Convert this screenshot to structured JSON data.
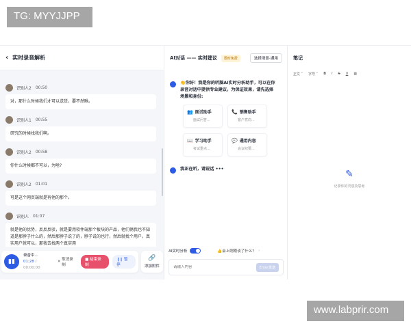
{
  "watermark_top": "TG: MYYJJPP",
  "watermark_bottom": "www.labprir.com",
  "left": {
    "title": "实时录音解析",
    "messages": [
      {
        "speaker": "识别人2",
        "time": "00:50",
        "text": "对，那什么时候我们才可以送货，要不然瞅。"
      },
      {
        "speaker": "识别人1",
        "time": "00:55",
        "text": "研究的时候找我们啊。"
      },
      {
        "speaker": "识别人2",
        "time": "00:58",
        "text": "你什么时候都不可以，为啥?"
      },
      {
        "speaker": "识别人2",
        "time": "01:01",
        "text": "可是这个网页端就是有他的那个。"
      },
      {
        "speaker": "识别人",
        "time": "01:07",
        "text": "就是他的优势，反反反驳，就是要用软件端那个板块的产品，他们俩我也不知道是那脖子什么的，然后那脖子说了的，脖子说的也行，然后就找个用户，真实用户就可以，那我去找两个真实用"
      }
    ],
    "recorder": {
      "status": "录音中...",
      "elapsed": "01:28",
      "total": "00:00:00",
      "cancel_label": "取消录制",
      "end_label": "结束录制",
      "pause_label": "暂停"
    },
    "attach_label": "添加附件"
  },
  "middle": {
    "title": "AI对话 —— 实时建议",
    "badge": "限时免费",
    "scene_button": "选择场景-通用",
    "greeting": "👏你好！我是你的听脑AI实时分析助手，可以在你录音对话中提供专业建议，为保证效果，请先选择场景和身份:",
    "cards": [
      {
        "icon": "👥",
        "title": "面试助手",
        "sub": "面试问答..."
      },
      {
        "icon": "📞",
        "title": "销售助手",
        "sub": "客户意向..."
      },
      {
        "icon": "📖",
        "title": "学习助手",
        "sub": "考试重点..."
      },
      {
        "icon": "💬",
        "title": "通用内容",
        "sub": "会议纪要..."
      }
    ],
    "listening": "我正在听，请说话",
    "ai_toggle_label": "AI实时分析",
    "hint": "👍会上刚刚谈了什么?",
    "input_placeholder": "请输入内容",
    "send_label": "Enter发送"
  },
  "right": {
    "title": "笔记",
    "toolbar": [
      "正文 ˅",
      "字号 ˅",
      "B",
      "I",
      "S",
      "U",
      "▦"
    ],
    "empty_text": "记录你的灵感及思考"
  }
}
